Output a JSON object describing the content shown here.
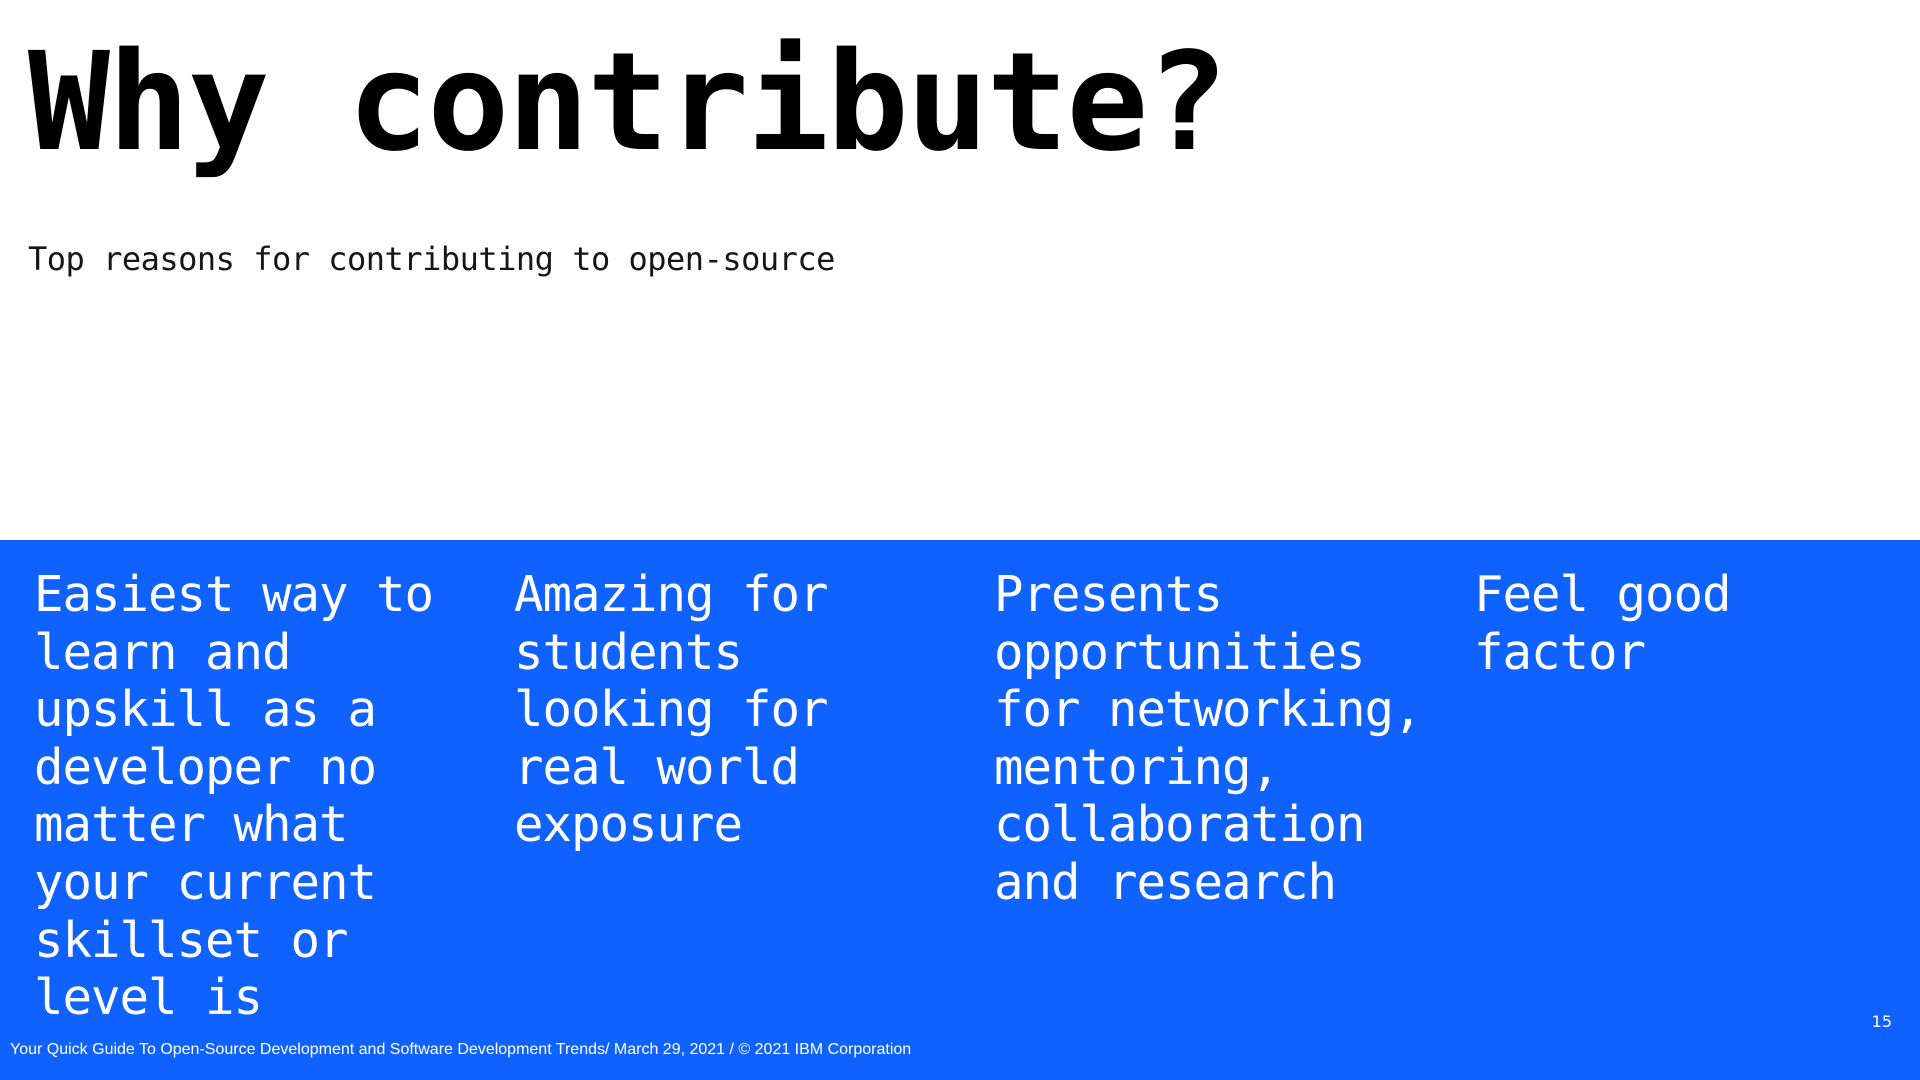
{
  "slide": {
    "title": "Why contribute?",
    "subtitle": "Top reasons for contributing to open-source",
    "reasons": [
      "Easiest way to learn and upskill as a developer no matter what your current skillset or level is",
      "Amazing for students looking for real world exposure",
      "Presents opportunities for networking, mentoring, collaboration and research",
      "Feel good factor"
    ],
    "page_number": "15",
    "footer": "Your Quick Guide To Open-Source Development and Software Development Trends/ March 29,  2021 / © 2021 IBM Corporation"
  },
  "colors": {
    "band": "#0f62fe",
    "title": "#000000",
    "band_text": "#ffffff"
  }
}
